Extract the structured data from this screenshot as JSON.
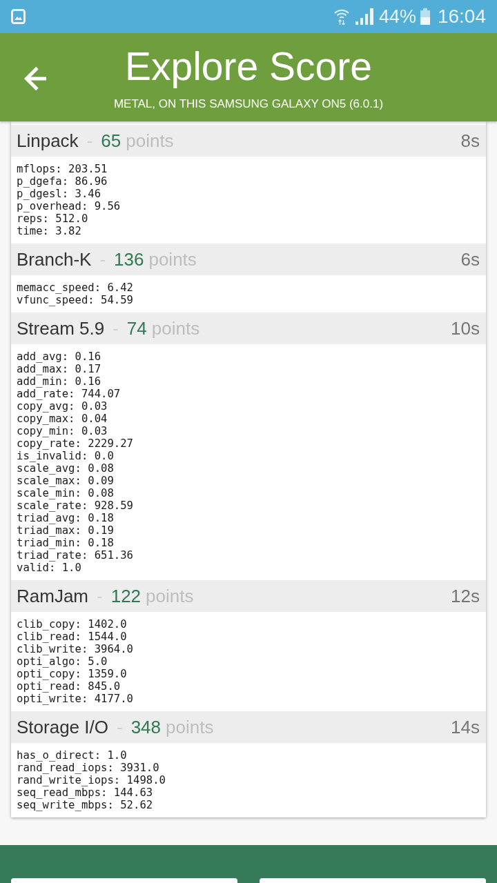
{
  "status_bar": {
    "battery": "44%",
    "time": "16:04"
  },
  "header": {
    "title": "Explore Score",
    "subtitle": "METAL, ON THIS SAMSUNG GALAXY ON5 (6.0.1)"
  },
  "sections": [
    {
      "name": "Linpack",
      "separator": "-",
      "score": "65",
      "unit": "points",
      "duration": "8s",
      "metrics": [
        "mflops: 203.51",
        "p_dgefa: 86.96",
        "p_dgesl: 3.46",
        "p_overhead: 9.56",
        "reps: 512.0",
        "time: 3.82"
      ]
    },
    {
      "name": "Branch-K",
      "separator": "-",
      "score": "136",
      "unit": "points",
      "duration": "6s",
      "metrics": [
        "memacc_speed: 6.42",
        "vfunc_speed: 54.59"
      ]
    },
    {
      "name": "Stream 5.9",
      "separator": "-",
      "score": "74",
      "unit": "points",
      "duration": "10s",
      "metrics": [
        "add_avg: 0.16",
        "add_max: 0.17",
        "add_min: 0.16",
        "add_rate: 744.07",
        "copy_avg: 0.03",
        "copy_max: 0.04",
        "copy_min: 0.03",
        "copy_rate: 2229.27",
        "is_invalid: 0.0",
        "scale_avg: 0.08",
        "scale_max: 0.09",
        "scale_min: 0.08",
        "scale_rate: 928.59",
        "triad_avg: 0.18",
        "triad_max: 0.19",
        "triad_min: 0.18",
        "triad_rate: 651.36",
        "valid: 1.0"
      ]
    },
    {
      "name": "RamJam",
      "separator": "-",
      "score": "122",
      "unit": "points",
      "duration": "12s",
      "metrics": [
        "clib_copy: 1402.0",
        "clib_read: 1544.0",
        "clib_write: 3964.0",
        "opti_algo: 5.0",
        "opti_copy: 1359.0",
        "opti_read: 845.0",
        "opti_write: 4177.0"
      ]
    },
    {
      "name": "Storage I/O",
      "separator": "-",
      "score": "348",
      "unit": "points",
      "duration": "14s",
      "metrics": [
        "has_o_direct: 1.0",
        "rand_read_iops: 3931.0",
        "rand_write_iops: 1498.0",
        "seq_read_mbps: 144.63",
        "seq_write_mbps: 52.62"
      ]
    }
  ]
}
